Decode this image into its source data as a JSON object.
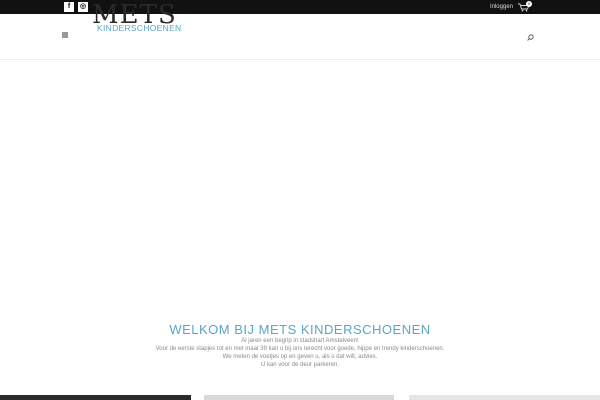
{
  "topbar": {
    "social": [
      {
        "glyph": "f"
      },
      {
        "glyph": "◎"
      }
    ],
    "login_label": "Inloggen",
    "cart_count": "0"
  },
  "header": {
    "logo_word": "METS",
    "logo_sub": "KINDERSCHOENEN"
  },
  "welcome": {
    "title": "WELKOM BIJ METS KINDERSCHOENEN",
    "lines": [
      "Al jaren een begrip in stadshart Amstelveen!",
      "Voor de eerste stapjes tot en met maat 39 kan u bij ons terecht voor goede, hippe en trendy kinderschoenen.",
      "We meten de voetjes op en geven u, als u dat wilt, advies.",
      "U kan voor de deur parkeren."
    ]
  },
  "colors": {
    "accent": "#5aa5c9",
    "topbar": "#111111"
  }
}
